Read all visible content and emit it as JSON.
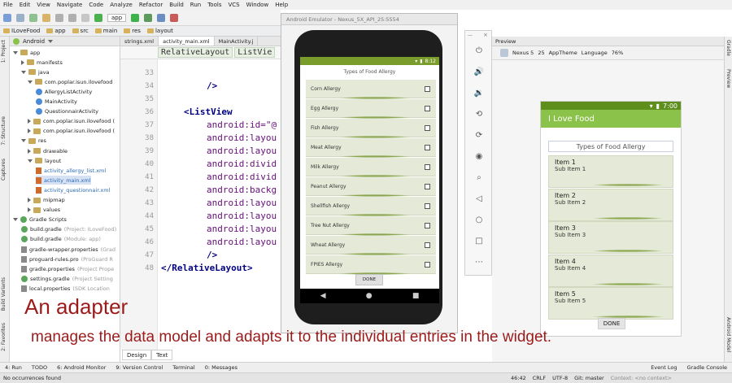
{
  "menu": [
    "File",
    "Edit",
    "View",
    "Navigate",
    "Code",
    "Analyze",
    "Refactor",
    "Build",
    "Run",
    "Tools",
    "VCS",
    "Window",
    "Help"
  ],
  "toolbar": {
    "run_config": "app"
  },
  "navbar": [
    "ILoveFood",
    "app",
    "src",
    "main",
    "res",
    "layout"
  ],
  "project_panel": {
    "view_mode": "Android",
    "tree": [
      {
        "label": "app",
        "icon": "folder-icon"
      },
      {
        "label": "manifests",
        "icon": "folder-icon"
      },
      {
        "label": "java",
        "icon": "folder-icon"
      },
      {
        "label": "com.poplar.isun.ilovefood",
        "icon": "folder-icon"
      },
      {
        "label": "AllergyListActivity",
        "icon": "class-icon"
      },
      {
        "label": "MainActivity",
        "icon": "class-icon"
      },
      {
        "label": "QuestionnairActivity",
        "icon": "class-icon"
      },
      {
        "label": "com.poplar.isun.ilovefood (",
        "icon": "folder-icon"
      },
      {
        "label": "com.poplar.isun.ilovefood (",
        "icon": "folder-icon"
      },
      {
        "label": "res",
        "icon": "folder-icon"
      },
      {
        "label": "drawable",
        "icon": "folder-icon"
      },
      {
        "label": "layout",
        "icon": "folder-icon"
      },
      {
        "label": "activity_allergy_list.xml",
        "icon": "xml-file-icon"
      },
      {
        "label": "activity_main.xml",
        "icon": "xml-file-icon"
      },
      {
        "label": "activity_questionnair.xml",
        "icon": "xml-file-icon"
      },
      {
        "label": "mipmap",
        "icon": "folder-icon"
      },
      {
        "label": "values",
        "icon": "folder-icon"
      },
      {
        "label": "Gradle Scripts",
        "icon": "gradle-icon"
      },
      {
        "label": "build.gradle",
        "icon": "gradle-icon",
        "note": "(Project: ILoveFood)"
      },
      {
        "label": "build.gradle",
        "icon": "gradle-icon",
        "note": "(Module: app)"
      },
      {
        "label": "gradle-wrapper.properties",
        "icon": "properties-icon",
        "note": "(Grad"
      },
      {
        "label": "proguard-rules.pro",
        "icon": "properties-icon",
        "note": "(ProGuard R"
      },
      {
        "label": "gradle.properties",
        "icon": "properties-icon",
        "note": "(Project Prope"
      },
      {
        "label": "settings.gradle",
        "icon": "gradle-icon",
        "note": "(Project Setting"
      },
      {
        "label": "local.properties",
        "icon": "properties-icon",
        "note": "(SDK Location"
      }
    ]
  },
  "editor": {
    "tabs": [
      "strings.xml",
      "activity_main.xml",
      "MainActivity.j"
    ],
    "breadcrumb": [
      "RelativeLayout",
      "ListVie"
    ],
    "line_numbers": [
      "33",
      "34",
      "35",
      "36",
      "37",
      "38",
      "39",
      "40",
      "41",
      "42",
      "43",
      "44",
      "45",
      "46",
      "47",
      "48"
    ],
    "lines": [
      {
        "text": "/>",
        "indent": 2,
        "kind": "tag"
      },
      {
        "text": "",
        "indent": 0,
        "kind": "blank"
      },
      {
        "text": "<ListView",
        "indent": 1,
        "kind": "tag"
      },
      {
        "text": "android:id=\"@",
        "indent": 2,
        "kind": "attr"
      },
      {
        "text": "android:layou",
        "indent": 2,
        "kind": "attr"
      },
      {
        "text": "android:layou",
        "indent": 2,
        "kind": "attr"
      },
      {
        "text": "android:divid",
        "indent": 2,
        "kind": "attr"
      },
      {
        "text": "android:divid",
        "indent": 2,
        "kind": "attr"
      },
      {
        "text": "android:backg",
        "indent": 2,
        "kind": "attr"
      },
      {
        "text": "android:layou",
        "indent": 2,
        "kind": "attr"
      },
      {
        "text": "android:layou",
        "indent": 2,
        "kind": "attr"
      },
      {
        "text": "android:layou",
        "indent": 2,
        "kind": "attr"
      },
      {
        "text": "android:layou",
        "indent": 2,
        "kind": "attr"
      },
      {
        "text": "/>",
        "indent": 2,
        "kind": "tag"
      },
      {
        "text": "</RelativeLayout>",
        "indent": 0,
        "kind": "tag"
      }
    ],
    "view_tabs": [
      "Design",
      "Text"
    ]
  },
  "emulator": {
    "window_title": "Android Emulator - Nexus_5X_API_25:5554",
    "status_time": "8:12",
    "list_title": "Types of Food Allergy",
    "items": [
      "Corn Allergy",
      "Egg Allergy",
      "Fish Allergy",
      "Meat Allergy",
      "Milk Allergy",
      "Peanut Allergy",
      "Shellfish Allergy",
      "Tree Nut Allergy",
      "Wheat Allergy",
      "FPIES Allergy"
    ],
    "done_label": "DONE",
    "nav": [
      "◀",
      "●",
      "■"
    ]
  },
  "emulator_controls": [
    "power-icon",
    "volume-up-icon",
    "volume-down-icon",
    "rotate-left-icon",
    "rotate-right-icon",
    "camera-icon",
    "zoom-icon",
    "back-icon",
    "home-icon",
    "overview-icon",
    "more-icon"
  ],
  "preview": {
    "panel_title": "Preview",
    "device": "Nexus 5",
    "api": "25",
    "theme": "AppTheme",
    "language": "Language",
    "zoom": "76%",
    "status_time": "7:00",
    "app_title": "I Love Food",
    "list_title": "Types of Food Allergy",
    "items": [
      {
        "title": "Item 1",
        "sub": "Sub Item 1"
      },
      {
        "title": "Item 2",
        "sub": "Sub Item 2"
      },
      {
        "title": "Item 3",
        "sub": "Sub Item 3"
      },
      {
        "title": "Item 4",
        "sub": "Sub Item 4"
      },
      {
        "title": "Item 5",
        "sub": "Sub Item 5"
      }
    ],
    "done_label": "DONE"
  },
  "side_tabs_left": [
    "1: Project",
    "7: Structure",
    "Captures",
    "Build Variants",
    "2: Favorites"
  ],
  "side_tabs_right": [
    "Gradle",
    "Preview",
    "Android Model"
  ],
  "tool_windows": [
    "4: Run",
    "TODO",
    "6: Android Monitor",
    "9: Version Control",
    "Terminal",
    "0: Messages",
    "Event Log",
    "Gradle Console"
  ],
  "status": {
    "message": "No occurrences found",
    "position": "46:42",
    "line_sep": "CRLF",
    "encoding": "UTF-8",
    "vcs": "Git: master",
    "context": "Context: <no context>"
  },
  "caption": {
    "title": "An adapter",
    "body": "manages the data model and adapts it to the individual entries in the widget."
  },
  "colors": {
    "caption": "#9b1b1b",
    "app_bar": "#8bc34a",
    "emulator_status": "#7a9c2a",
    "list_item": "#e5ead8"
  }
}
